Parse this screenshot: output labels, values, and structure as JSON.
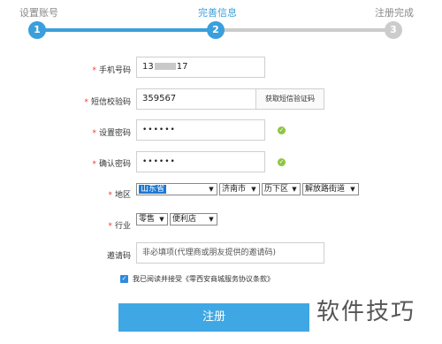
{
  "steps": [
    {
      "label": "设置账号",
      "num": "1"
    },
    {
      "label": "完善信息",
      "num": "2"
    },
    {
      "label": "注册完成",
      "num": "3"
    }
  ],
  "form": {
    "phone": {
      "label": "手机号码",
      "prefix": "13",
      "suffix": "17"
    },
    "sms": {
      "label": "短信校验码",
      "value": "359567",
      "button": "获取短信验证码"
    },
    "password": {
      "label": "设置密码",
      "value": "••••••"
    },
    "confirm": {
      "label": "确认密码",
      "value": "••••••"
    },
    "region": {
      "label": "地区",
      "province": "山东省",
      "city": "济南市",
      "district": "历下区",
      "street": "解放路街道"
    },
    "industry": {
      "label": "行业",
      "type": "零售",
      "subtype": "便利店"
    },
    "invite": {
      "label": "邀请码",
      "placeholder": "非必填项(代理商或朋友提供的邀请码)"
    },
    "agree": {
      "text": "我已阅读并接受《零西安商城服务协议条款》"
    },
    "submit": "注册"
  },
  "watermark": "软件技巧",
  "colors": {
    "active": "#3a9fdc",
    "inactive": "#cccccc",
    "button": "#3fa8e4",
    "ok": "#8cc63f"
  }
}
